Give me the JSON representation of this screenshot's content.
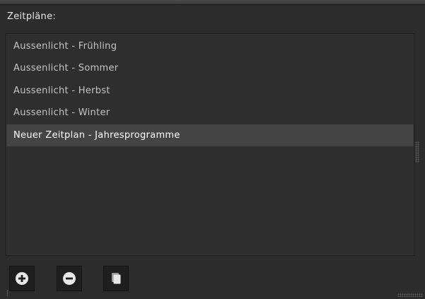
{
  "panel": {
    "title": "Zeitpläne:"
  },
  "schedules": {
    "items": [
      {
        "label": "Aussenlicht - Frühling",
        "selected": false
      },
      {
        "label": "Aussenlicht - Sommer",
        "selected": false
      },
      {
        "label": "Aussenlicht - Herbst",
        "selected": false
      },
      {
        "label": "Aussenlicht - Winter",
        "selected": false
      },
      {
        "label": "Neuer Zeitplan - Jahresprogramme",
        "selected": true
      }
    ]
  },
  "toolbar": {
    "buttons": [
      {
        "name": "add-schedule-button",
        "icon": "plus-circle-icon"
      },
      {
        "name": "remove-schedule-button",
        "icon": "minus-circle-icon"
      },
      {
        "name": "copy-schedule-button",
        "icon": "copy-icon"
      }
    ]
  },
  "colors": {
    "background": "#2c2c2c",
    "list_background": "#2e2e2e",
    "selected_row": "#444444",
    "text": "#c4c4c4",
    "selected_text": "#ffffff"
  }
}
